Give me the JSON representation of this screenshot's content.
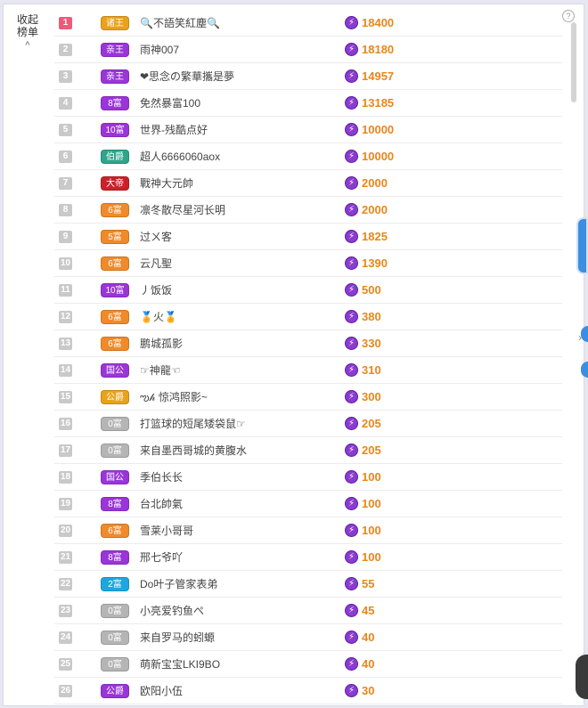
{
  "header": {
    "collapse_line1": "收起",
    "collapse_line2": "榜单",
    "collapse_chevron": "^",
    "help_symbol": "?"
  },
  "colors": {
    "gold": "#e9a21a",
    "purple": "#9a35d8",
    "orange": "#f08a2a",
    "teal": "#2ea58a",
    "red": "#c8232a",
    "grey": "#b5b5b5",
    "cyan": "#1fa7dc",
    "score": "#e9861a"
  },
  "rows": [
    {
      "rank": "1",
      "badge": "诸王",
      "badge_color": "gold",
      "name": "🔍不語笑紅塵🔍",
      "score": "18400"
    },
    {
      "rank": "2",
      "badge": "亲王",
      "badge_color": "purple",
      "name": "雨神007",
      "score": "18180"
    },
    {
      "rank": "3",
      "badge": "亲王",
      "badge_color": "purple",
      "name": "❤思念の繁華攜是夢",
      "score": "14957"
    },
    {
      "rank": "4",
      "badge": "8富",
      "badge_color": "purple",
      "name": "免然暴富100",
      "score": "13185"
    },
    {
      "rank": "5",
      "badge": "10富",
      "badge_color": "purple",
      "name": "世界-残酷点好",
      "score": "10000"
    },
    {
      "rank": "6",
      "badge": "伯爵",
      "badge_color": "teal",
      "name": "超人6666060aox",
      "score": "10000"
    },
    {
      "rank": "7",
      "badge": "大帝",
      "badge_color": "red",
      "name": "戰神大元帥",
      "score": "2000"
    },
    {
      "rank": "8",
      "badge": "6富",
      "badge_color": "orange",
      "name": "凛冬散尽星河长明",
      "score": "2000"
    },
    {
      "rank": "9",
      "badge": "5富",
      "badge_color": "orange",
      "name": "过ㄨ客",
      "score": "1825"
    },
    {
      "rank": "10",
      "badge": "6富",
      "badge_color": "orange",
      "name": "云凡聖",
      "score": "1390"
    },
    {
      "rank": "11",
      "badge": "10富",
      "badge_color": "purple",
      "name": "丿饭饭",
      "score": "500"
    },
    {
      "rank": "12",
      "badge": "6富",
      "badge_color": "orange",
      "name": "🏅火🏅",
      "score": "380"
    },
    {
      "rank": "13",
      "badge": "6富",
      "badge_color": "orange",
      "name": "鹏城孤影",
      "score": "330"
    },
    {
      "rank": "14",
      "badge": "国公",
      "badge_color": "purple",
      "name": "☞神龍☜",
      "score": "310"
    },
    {
      "rank": "15",
      "badge": "公爵",
      "badge_color": "gold",
      "name": "ఌ𝒽 惊鸿照影~",
      "score": "300"
    },
    {
      "rank": "16",
      "badge": "0富",
      "badge_color": "grey",
      "name": "打篮球的短尾矮袋鼠☞",
      "score": "205"
    },
    {
      "rank": "17",
      "badge": "0富",
      "badge_color": "grey",
      "name": "来自墨西哥城的黄腹水",
      "score": "205"
    },
    {
      "rank": "18",
      "badge": "国公",
      "badge_color": "purple",
      "name": "季伯长长",
      "score": "100"
    },
    {
      "rank": "19",
      "badge": "8富",
      "badge_color": "purple",
      "name": "台北帥氣",
      "score": "100"
    },
    {
      "rank": "20",
      "badge": "6富",
      "badge_color": "orange",
      "name": "雪莱小哥哥",
      "score": "100"
    },
    {
      "rank": "21",
      "badge": "8富",
      "badge_color": "purple",
      "name": "邢七爷吖",
      "score": "100"
    },
    {
      "rank": "22",
      "badge": "2富",
      "badge_color": "cyan",
      "name": "Do叶子管家表弟",
      "score": "55"
    },
    {
      "rank": "23",
      "badge": "0富",
      "badge_color": "grey",
      "name": "小亮爱钓鱼ぺ",
      "score": "45"
    },
    {
      "rank": "24",
      "badge": "0富",
      "badge_color": "grey",
      "name": "来自罗马的蚓螈",
      "score": "40"
    },
    {
      "rank": "25",
      "badge": "0富",
      "badge_color": "grey",
      "name": "萌新宝宝LKI9BO",
      "score": "40"
    },
    {
      "rank": "26",
      "badge": "公爵",
      "badge_color": "purple",
      "name": "欧阳小伍",
      "score": "30"
    }
  ]
}
